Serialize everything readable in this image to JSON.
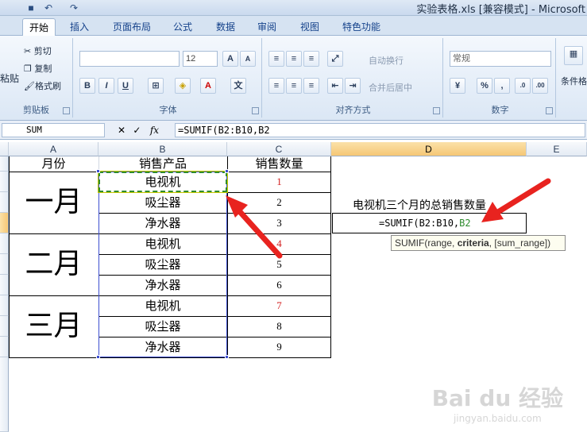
{
  "window": {
    "title": "实验表格.xls  [兼容模式] - Microsoft"
  },
  "tabs": [
    "开始",
    "插入",
    "页面布局",
    "公式",
    "数据",
    "审阅",
    "视图",
    "特色功能"
  ],
  "ribbon": {
    "clipboard": {
      "paste": "粘贴",
      "cut": "剪切",
      "copy": "复制",
      "format_painter": "格式刷",
      "label": "剪贴板"
    },
    "font": {
      "font_name": "",
      "font_size": "12",
      "grow": "A",
      "shrink": "A",
      "bold": "B",
      "italic": "I",
      "underline": "U",
      "label": "字体"
    },
    "alignment": {
      "wrap_text": "自动换行",
      "merge_center": "合并后居中",
      "label": "对齐方式"
    },
    "number": {
      "format": "常规",
      "percent": "%",
      "comma": ",",
      "label": "数字"
    },
    "styles": {
      "conditional": "条件格"
    }
  },
  "formula_bar": {
    "name_box": "SUM",
    "cancel_icon": "✕",
    "enter_icon": "✓",
    "fx": "fx",
    "formula": "=SUMIF(B2:B10,B2"
  },
  "columns": [
    "A",
    "B",
    "C",
    "D",
    "E"
  ],
  "sheet": {
    "header_a": "月份",
    "header_b": "销售产品",
    "header_c": "销售数量",
    "months": [
      "一月",
      "二月",
      "三月"
    ],
    "rows": [
      {
        "product": "电视机",
        "qty": "1",
        "red": true
      },
      {
        "product": "吸尘器",
        "qty": "2",
        "red": false
      },
      {
        "product": "净水器",
        "qty": "3",
        "red": false
      },
      {
        "product": "电视机",
        "qty": "4",
        "red": true
      },
      {
        "product": "吸尘器",
        "qty": "5",
        "red": false
      },
      {
        "product": "净水器",
        "qty": "6",
        "red": false
      },
      {
        "product": "电视机",
        "qty": "7",
        "red": true
      },
      {
        "product": "吸尘器",
        "qty": "8",
        "red": false
      },
      {
        "product": "净水器",
        "qty": "9",
        "red": false
      }
    ],
    "label_d": "电视机三个月的总销售数量",
    "edit_prefix": "=SUMIF(B2:B10,",
    "edit_ref": "B2",
    "tooltip_func": "SUMIF(range, ",
    "tooltip_bold": "criteria",
    "tooltip_rest": ", [sum_range])"
  },
  "watermark": {
    "brand": "Bai du 经验",
    "url": "jingyan.baidu.com"
  }
}
